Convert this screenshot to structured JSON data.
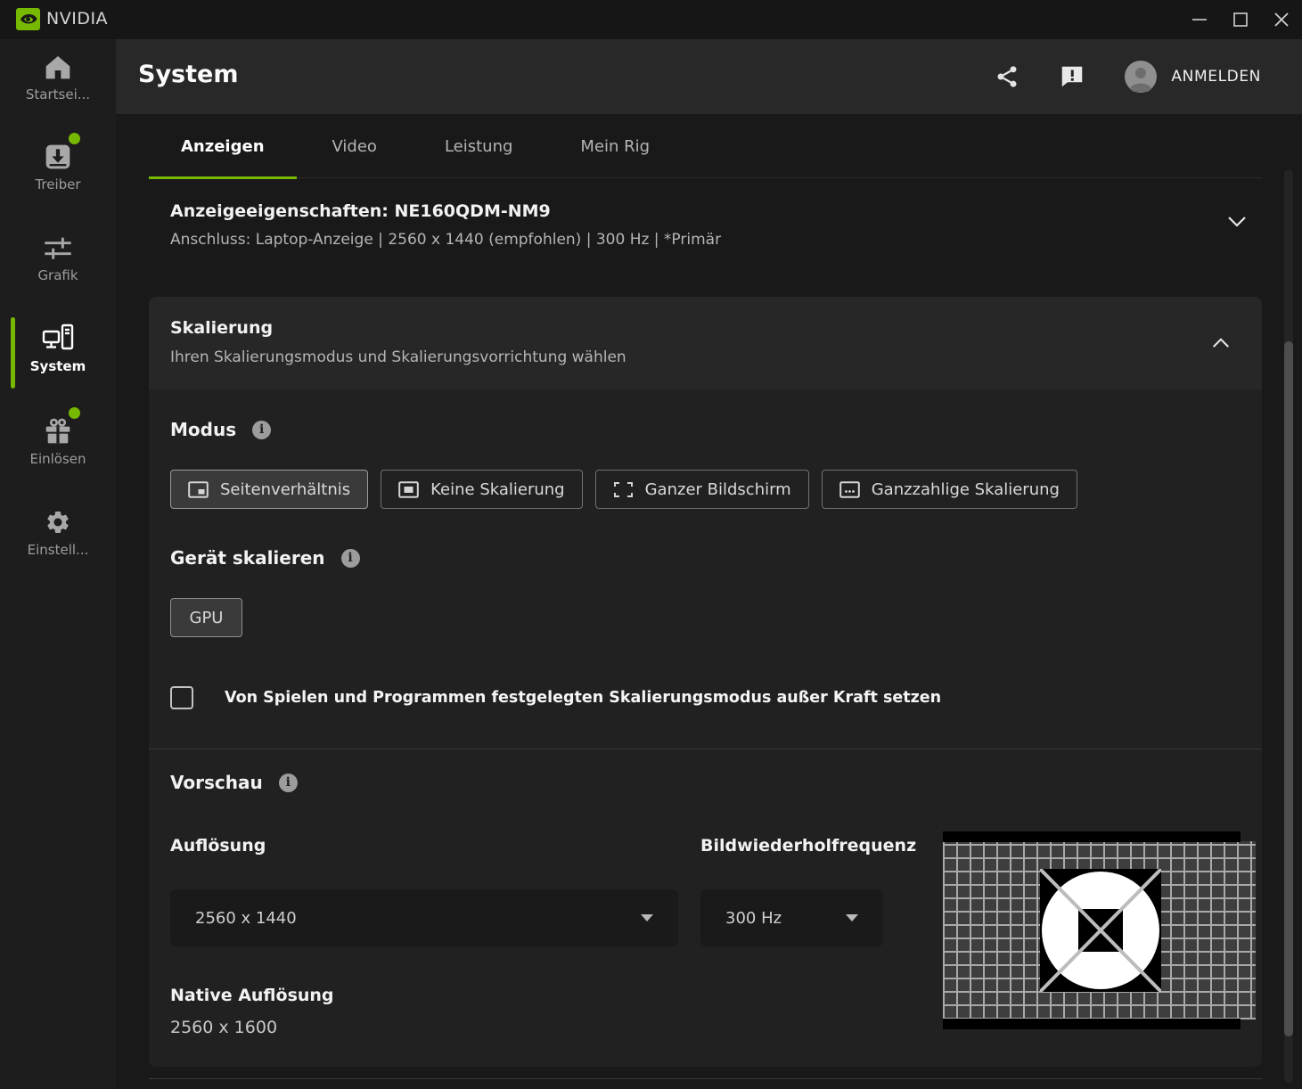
{
  "titlebar": {
    "app_name": "NVIDIA"
  },
  "sidebar": {
    "items": [
      {
        "label": "Startsei...",
        "icon": "home",
        "active": false,
        "badge": false
      },
      {
        "label": "Treiber",
        "icon": "driver-download",
        "active": false,
        "badge": true
      },
      {
        "label": "Grafik",
        "icon": "sliders",
        "active": false,
        "badge": false
      },
      {
        "label": "System",
        "icon": "computer",
        "active": true,
        "badge": false
      },
      {
        "label": "Einlösen",
        "icon": "gift",
        "active": false,
        "badge": true
      },
      {
        "label": "Einstell...",
        "icon": "gear",
        "active": false,
        "badge": false
      }
    ]
  },
  "header": {
    "title": "System",
    "signin_label": "ANMELDEN"
  },
  "tabs": [
    {
      "label": "Anzeigen",
      "active": true
    },
    {
      "label": "Video",
      "active": false
    },
    {
      "label": "Leistung",
      "active": false
    },
    {
      "label": "Mein Rig",
      "active": false
    }
  ],
  "display_properties": {
    "title": "Anzeigeeigenschaften: NE160QDM-NM9",
    "subtitle": "Anschluss: Laptop-Anzeige | 2560 x 1440 (empfohlen) | 300 Hz | *Primär"
  },
  "scaling": {
    "title": "Skalierung",
    "subtitle": "Ihren Skalierungsmodus und Skalierungsvorrichtung wählen",
    "mode_label": "Modus",
    "modes": [
      {
        "label": "Seitenverhältnis",
        "selected": true
      },
      {
        "label": "Keine Skalierung",
        "selected": false
      },
      {
        "label": "Ganzer Bildschirm",
        "selected": false
      },
      {
        "label": "Ganzzahlige Skalierung",
        "selected": false
      }
    ],
    "device_label": "Gerät skalieren",
    "device_value": "GPU",
    "override_label": "Von Spielen und Programmen festgelegten Skalierungsmodus außer Kraft setzen",
    "override_checked": false,
    "preview_label": "Vorschau",
    "resolution_label": "Auflösung",
    "resolution_value": "2560 x 1440",
    "refresh_label": "Bildwiederholfrequenz",
    "refresh_value": "300 Hz",
    "native_label": "Native Auflösung",
    "native_value": "2560 x 1600"
  },
  "colors": {
    "accent": "#76b900",
    "card_bg": "#212121",
    "header_bg": "#282828"
  }
}
